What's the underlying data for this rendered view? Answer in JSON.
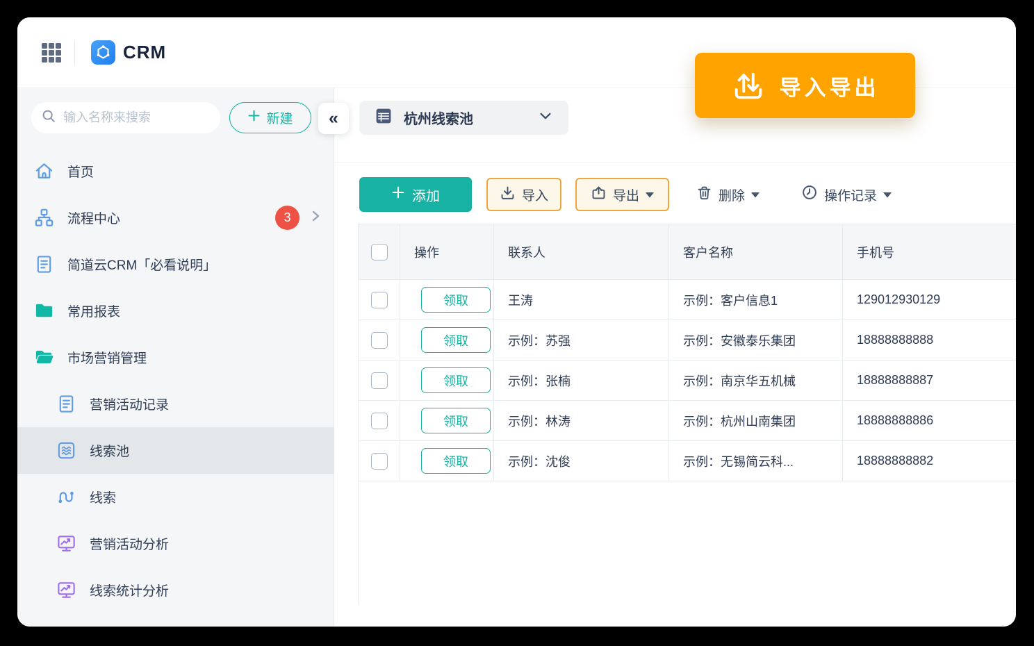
{
  "app": {
    "name": "CRM"
  },
  "floating_button": {
    "label": "导入导出"
  },
  "sidebar": {
    "search_placeholder": "输入名称来搜索",
    "new_button_label": "新建",
    "items": [
      {
        "label": "首页",
        "icon": "home-icon"
      },
      {
        "label": "流程中心",
        "icon": "workflow-icon",
        "badge": "3"
      },
      {
        "label": "简道云CRM「必看说明」",
        "icon": "document-icon"
      },
      {
        "label": "常用报表",
        "icon": "folder-icon"
      },
      {
        "label": "市场营销管理",
        "icon": "folder-open-icon"
      },
      {
        "label": "营销活动记录",
        "icon": "document-icon"
      },
      {
        "label": "线索池",
        "icon": "pool-icon",
        "selected": true
      },
      {
        "label": "线索",
        "icon": "route-icon"
      },
      {
        "label": "营销活动分析",
        "icon": "monitor-chart-icon"
      },
      {
        "label": "线索统计分析",
        "icon": "monitor-chart-icon"
      }
    ]
  },
  "main": {
    "pool_selector": {
      "label": "杭州线索池"
    },
    "toolbar": {
      "add_label": "添加",
      "import_label": "导入",
      "export_label": "导出",
      "delete_label": "删除",
      "records_label": "操作记录"
    },
    "table": {
      "claim_label": "领取",
      "columns": [
        "操作",
        "联系人",
        "客户名称",
        "手机号"
      ],
      "rows": [
        {
          "contact": "王涛",
          "customer": "示例：客户信息1",
          "phone": "129012930129"
        },
        {
          "contact": "示例：苏强",
          "customer": "示例：安徽泰乐集团",
          "phone": "18888888888"
        },
        {
          "contact": "示例：张楠",
          "customer": "示例：南京华五机械",
          "phone": "18888888887"
        },
        {
          "contact": "示例：林涛",
          "customer": "示例：杭州山南集团",
          "phone": "18888888886"
        },
        {
          "contact": "示例：沈俊",
          "customer": "示例：无锡简云科...",
          "phone": "18888888882"
        }
      ]
    }
  },
  "colors": {
    "accent_teal": "#17b2a4",
    "accent_orange": "#ffa300",
    "cream_button_bg": "#fdf7e9",
    "cream_button_border": "#f0a63c",
    "badge_red": "#ee5244",
    "icon_blue": "#5f9ce2",
    "icon_purple": "#a06ee8",
    "sidebar_bg": "#f4f6f7",
    "selected_item_bg": "#e3e7e9",
    "text_dark": "#2e3c55"
  }
}
